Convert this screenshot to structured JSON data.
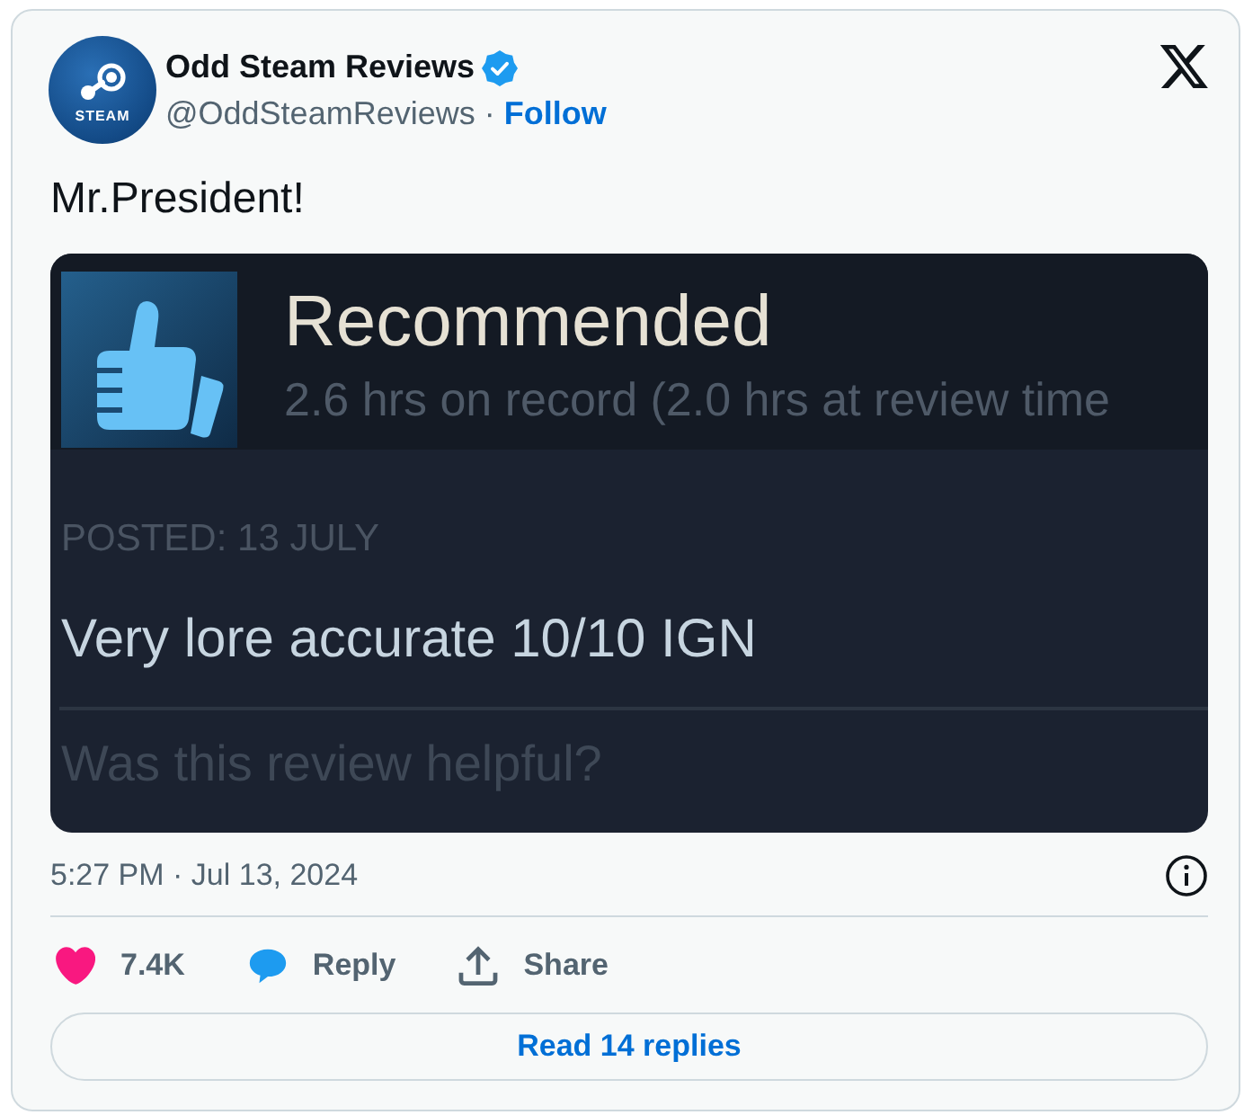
{
  "tweet": {
    "author": {
      "avatar_label": "STEAM",
      "name": "Odd Steam Reviews",
      "verified": true,
      "handle": "@OddSteamReviews",
      "separator": "·",
      "follow": "Follow"
    },
    "text": "Mr.President!",
    "review_image": {
      "verdict": "Recommended",
      "hours": "2.6 hrs on record (2.0 hrs at review time",
      "posted": "POSTED: 13 JULY",
      "body": "Very lore accurate 10/10 IGN",
      "helpful_prompt": "Was this review helpful?"
    },
    "timestamp": "5:27 PM · Jul 13, 2024",
    "actions": [
      {
        "kind": "like",
        "label": "7.4K"
      },
      {
        "kind": "reply",
        "label": "Reply"
      },
      {
        "kind": "share",
        "label": "Share"
      }
    ],
    "read_replies": "Read 14 replies"
  }
}
